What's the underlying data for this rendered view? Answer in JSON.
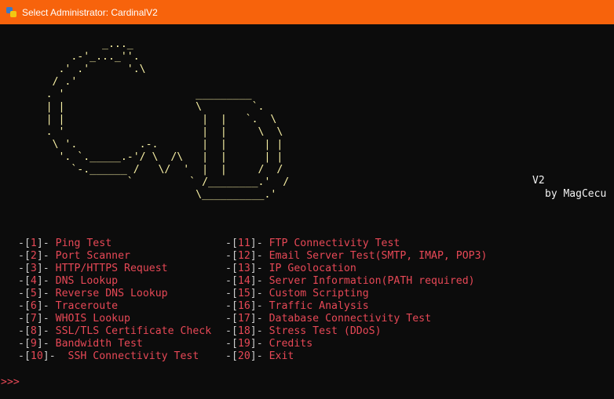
{
  "window": {
    "title": "Select Administrator:  CardinalV2"
  },
  "banner": {
    "art": "                _..._\n           .-'_..._''.\n         .' .'      '.\\\n        / .'\n       . '                     _________\n       | |                     \\        `.\n       | |                      |  |   `.  \\\n       . '                      |  |     \\  \\\n        \\ '.          .-.       |  |      | |\n         '. `._____.-'/ \\  /\\   |  |      | |\n           `-.______ /   \\/  '  |  |     /  /\n                    `         ` /________.'  /\n                               \\__________.'",
    "version": "V2",
    "byline": "by MagCecu"
  },
  "menu": {
    "left": [
      {
        "num": "1",
        "label": "Ping Test"
      },
      {
        "num": "2",
        "label": "Port Scanner"
      },
      {
        "num": "3",
        "label": "HTTP/HTTPS Request"
      },
      {
        "num": "4",
        "label": "DNS Lookup"
      },
      {
        "num": "5",
        "label": "Reverse DNS Lookup"
      },
      {
        "num": "6",
        "label": "Traceroute"
      },
      {
        "num": "7",
        "label": "WHOIS Lookup"
      },
      {
        "num": "8",
        "label": "SSL/TLS Certificate Check"
      },
      {
        "num": "9",
        "label": "Bandwidth Test"
      },
      {
        "num": "10",
        "label": "SSH Connectivity Test"
      }
    ],
    "right": [
      {
        "num": "11",
        "label": "FTP Connectivity Test"
      },
      {
        "num": "12",
        "label": "Email Server Test(SMTP, IMAP, POP3)"
      },
      {
        "num": "13",
        "label": "IP Geolocation"
      },
      {
        "num": "14",
        "label": "Server Information(PATH required)"
      },
      {
        "num": "15",
        "label": "Custom Scripting"
      },
      {
        "num": "16",
        "label": "Traffic Analysis"
      },
      {
        "num": "17",
        "label": "Database Connectivity Test"
      },
      {
        "num": "18",
        "label": "Stress Test (DDoS)"
      },
      {
        "num": "19",
        "label": "Credits"
      },
      {
        "num": "20",
        "label": "Exit"
      }
    ]
  },
  "prompt": ">>>",
  "colors": {
    "titlebar": "#f7630c",
    "background": "#0c0c0c",
    "accent": "#e74856",
    "banner": "#f9f1a5"
  }
}
